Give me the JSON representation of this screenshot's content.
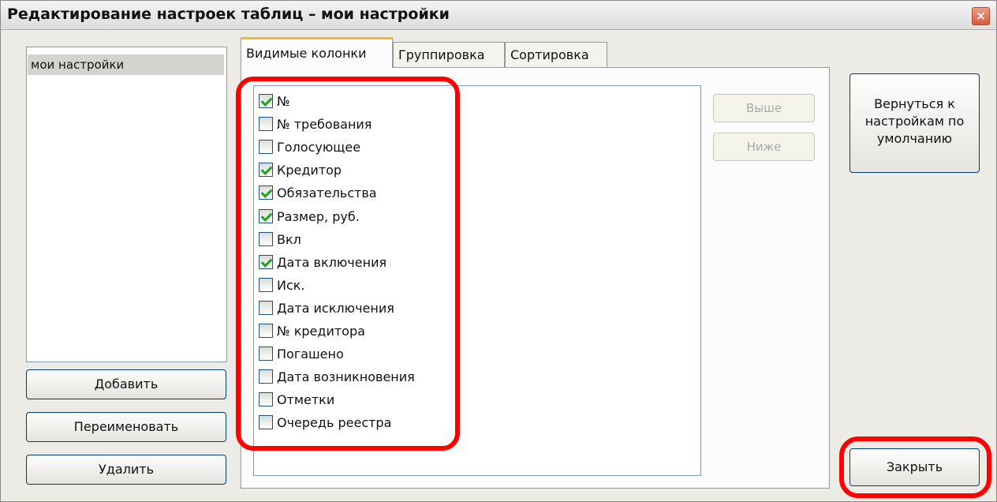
{
  "window": {
    "title": "Редактирование настроек таблиц – мои настройки",
    "close_glyph": "×"
  },
  "settings_list": {
    "items": [
      {
        "label": "мои настройки",
        "selected": true
      }
    ]
  },
  "left_buttons": {
    "add": "Добавить",
    "rename": "Переименовать",
    "delete": "Удалить"
  },
  "tabs": [
    {
      "label": "Видимые колонки",
      "active": true
    },
    {
      "label": "Группировка",
      "active": false
    },
    {
      "label": "Сортировка",
      "active": false
    }
  ],
  "columns": [
    {
      "label": "№",
      "checked": true
    },
    {
      "label": "№ требования",
      "checked": false
    },
    {
      "label": "Голосующее",
      "checked": false
    },
    {
      "label": "Кредитор",
      "checked": true
    },
    {
      "label": "Обязательства",
      "checked": true
    },
    {
      "label": "Размер, руб.",
      "checked": true
    },
    {
      "label": "Вкл",
      "checked": false
    },
    {
      "label": "Дата включения",
      "checked": true
    },
    {
      "label": "Иск.",
      "checked": false
    },
    {
      "label": "Дата исключения",
      "checked": false
    },
    {
      "label": "№ кредитора",
      "checked": false
    },
    {
      "label": "Погашено",
      "checked": false
    },
    {
      "label": "Дата возникновения",
      "checked": false
    },
    {
      "label": "Отметки",
      "checked": false
    },
    {
      "label": "Очередь реестра",
      "checked": false
    }
  ],
  "order_buttons": {
    "up": "Выше",
    "down": "Ниже"
  },
  "right_buttons": {
    "reset_line1": "Вернуться к",
    "reset_line2": "настройкам по",
    "reset_line3": "умолчанию",
    "close": "Закрыть"
  },
  "colors": {
    "highlight": "#ff0000",
    "check": "#21a121",
    "active_tab_accent": "#f6b73c"
  }
}
